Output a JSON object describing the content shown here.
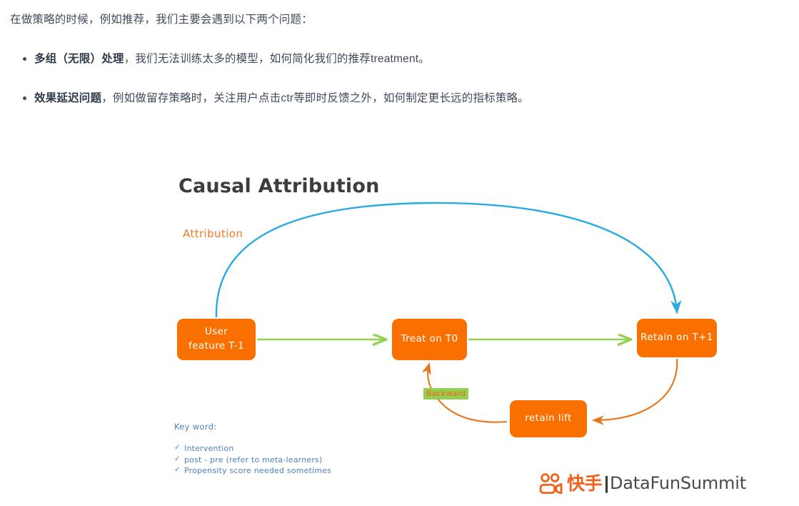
{
  "article": {
    "intro": "在做策略的时候，例如推荐，我们主要会遇到以下两个问题：",
    "bullets": [
      {
        "bold": "多组（无限）处理",
        "rest": "，我们无法训练太多的模型，如何简化我们的推荐treatment。"
      },
      {
        "bold": "效果延迟问题",
        "rest": "，例如做留存策略时，关注用户点击ctr等即时反馈之外，如何制定更长远的指标策略。"
      }
    ]
  },
  "slide": {
    "title": "Causal Attribution",
    "attribution_label": "Attribution",
    "backward_label": "Backward",
    "nodes": [
      {
        "id": "user",
        "line1": "User",
        "line2": "feature T-1"
      },
      {
        "id": "treat",
        "line1": "Treat on T0",
        "line2": ""
      },
      {
        "id": "retain",
        "line1": "Retain on T+1",
        "line2": ""
      },
      {
        "id": "lift",
        "line1": "retain lift",
        "line2": ""
      }
    ],
    "keyword": {
      "title": "Key word:",
      "check_glyph": "✓",
      "items": [
        "Intervention",
        "post - pre (refer to  meta-learners)",
        "Propensity score needed sometimes"
      ]
    },
    "logo": {
      "icon_name": "kuaishou-logo-icon",
      "cn": "快手",
      "separator": "|",
      "en": "DataFunSummit"
    },
    "colors": {
      "node_orange": "#FA7000",
      "arrow_green": "#92D050",
      "arrow_blue": "#29ABE2",
      "arrow_orange": "#E8761B",
      "keyword_blue": "#4F81BD",
      "text_slate": "#3f4a5b",
      "backward_bg": "#92D050"
    }
  }
}
